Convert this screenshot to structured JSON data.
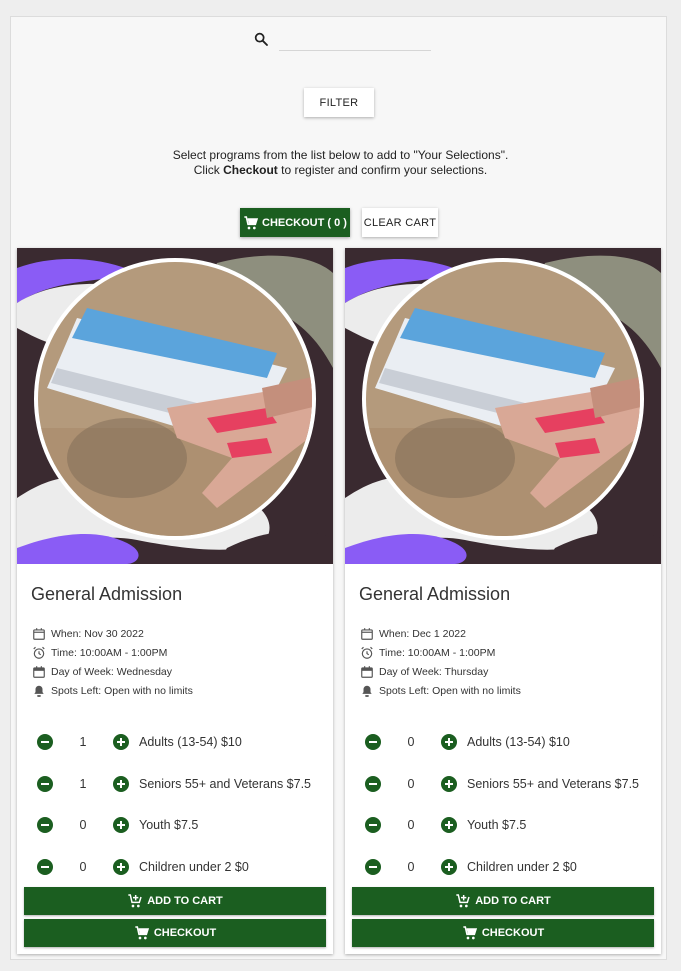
{
  "search": {
    "placeholder": "",
    "value": ""
  },
  "filter_label": "FILTER",
  "intro": {
    "line1": "Select programs from the list below to add to \"Your Selections\".",
    "line2_pre": "Click ",
    "line2_bold": "Checkout",
    "line2_post": " to register and confirm your selections."
  },
  "cart": {
    "checkout_label": "CHECKOUT ( 0 )",
    "clear_label": "CLEAR CART"
  },
  "colors": {
    "accent": "#1b5e20",
    "blob_purple": "#8a5cf5",
    "blob_dark": "#3a2a30",
    "blob_taupe": "#8e8f7e"
  },
  "cards": [
    {
      "title": "General Admission",
      "when": "When: Nov 30 2022",
      "time": "Time: 10:00AM - 1:00PM",
      "day": "Day of Week: Wednesday",
      "spots": "Spots Left: Open with no limits",
      "tickets": [
        {
          "qty": "1",
          "label": "Adults (13-54) $10"
        },
        {
          "qty": "1",
          "label": "Seniors 55+ and Veterans $7.5"
        },
        {
          "qty": "0",
          "label": "Youth $7.5"
        },
        {
          "qty": "0",
          "label": "Children under 2 $0"
        }
      ],
      "add_label": "ADD TO CART",
      "checkout_label": "CHECKOUT"
    },
    {
      "title": "General Admission",
      "when": "When: Dec 1 2022",
      "time": "Time: 10:00AM - 1:00PM",
      "day": "Day of Week: Thursday",
      "spots": "Spots Left: Open with no limits",
      "tickets": [
        {
          "qty": "0",
          "label": "Adults (13-54) $10"
        },
        {
          "qty": "0",
          "label": "Seniors 55+ and Veterans $7.5"
        },
        {
          "qty": "0",
          "label": "Youth $7.5"
        },
        {
          "qty": "0",
          "label": "Children under 2 $0"
        }
      ],
      "add_label": "ADD TO CART",
      "checkout_label": "CHECKOUT"
    }
  ]
}
